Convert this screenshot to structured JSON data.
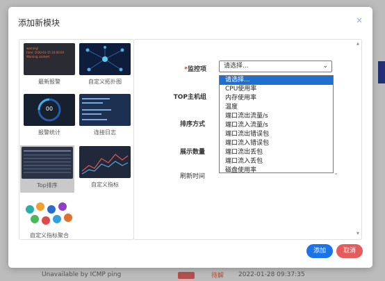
{
  "background": {
    "row_text": "Unavailable by ICMP ping",
    "row_status": "待解",
    "row_time": "2022-01-28 09:37:35"
  },
  "modal": {
    "title": "添加新模块",
    "close_icon": "×"
  },
  "widgets": [
    {
      "label": "最新报警",
      "thumb_lines": [
        "warning!",
        "time: 2020-03-15 10:00:00",
        "Warning content"
      ]
    },
    {
      "label": "自定义拓扑图"
    },
    {
      "label": "报警统计",
      "thumb_value": "00"
    },
    {
      "label": "连接日志"
    },
    {
      "label": "Top排序",
      "selected": true
    },
    {
      "label": "自定义指标"
    },
    {
      "label": "自定义指标聚合"
    }
  ],
  "form": {
    "monitor_label": "监控项",
    "required_mark": "*",
    "top_host_label": "TOP主机组",
    "sort_label": "排序方式",
    "count_label": "展示数量",
    "refresh_label": "刷新时间",
    "select_value": "请选择...",
    "select_icon": "chevron-down-icon",
    "options": [
      "请选择...",
      "CPU使用率",
      "内存使用率",
      "温度",
      "端口流出流量/s",
      "端口流入流量/s",
      "端口流出错误包",
      "端口流入错误包",
      "端口流出丢包",
      "端口流入丢包",
      "磁盘使用率"
    ]
  },
  "footer": {
    "add_label": "添加",
    "cancel_label": "取消"
  },
  "colors": {
    "primary": "#1a73e8",
    "danger": "#e55c5c",
    "dropdown_highlight": "#1f6fd0"
  }
}
